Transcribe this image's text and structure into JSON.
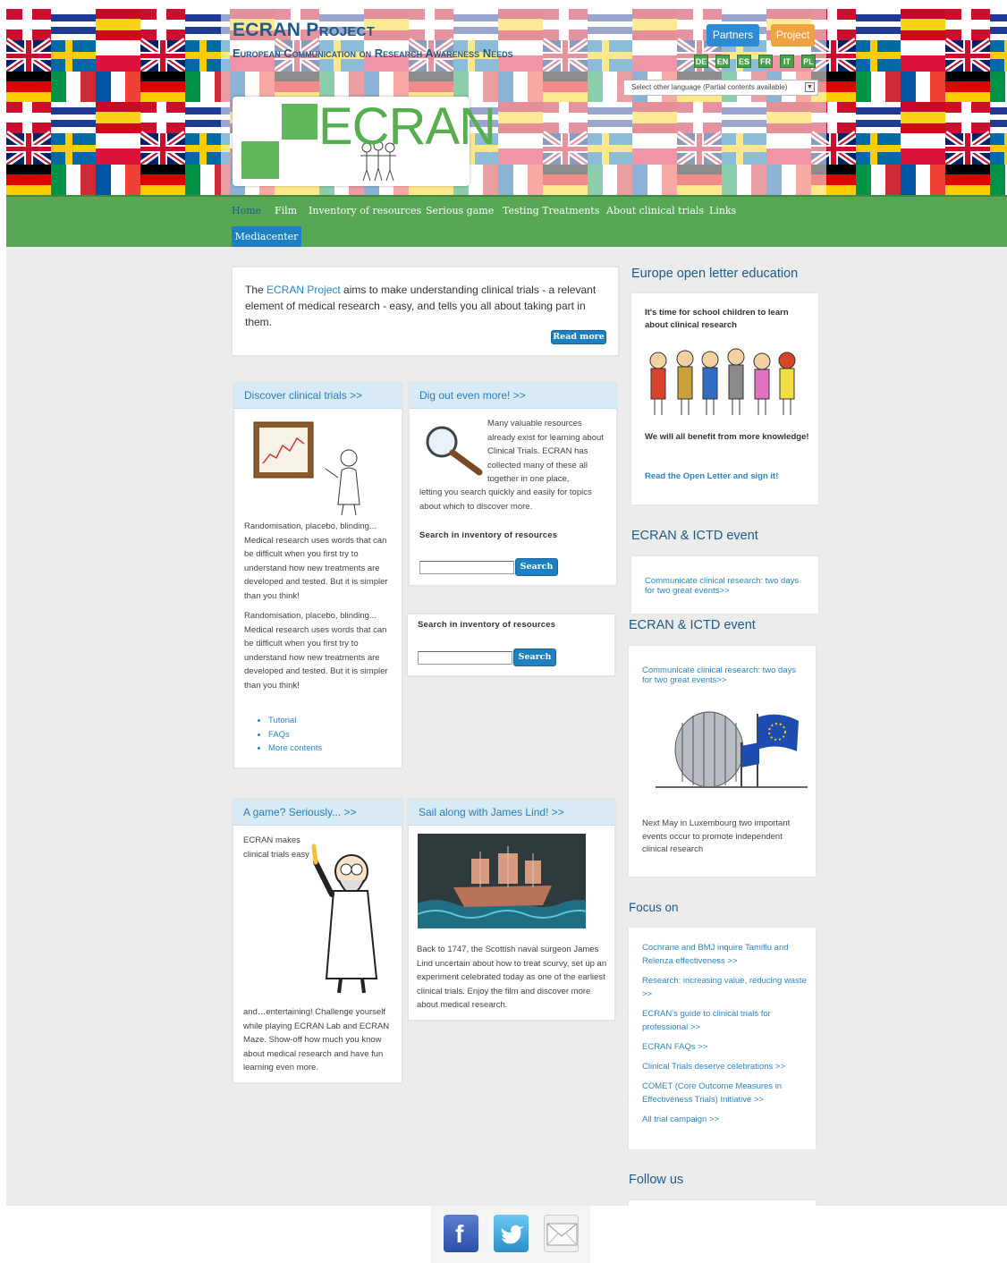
{
  "header": {
    "title": "ECRAN Project",
    "subtitle": "European Communication on Research Awareness Needs",
    "partners_label": "Partners",
    "project_label": "Project",
    "languages": [
      "DE",
      "EN",
      "ES",
      "FR",
      "IT",
      "PL"
    ],
    "language_select": "Select other language (Partial contents available)",
    "logo_text": "ECRAN"
  },
  "nav": {
    "items": [
      "Home",
      "Film",
      "Inventory of resources",
      "Serious game",
      "Testing Treatments",
      "About clinical trials",
      "Links"
    ],
    "mediacenter": "Mediacenter"
  },
  "intro": {
    "prefix": "The ",
    "link": "ECRAN Project",
    "text": " aims to make understanding clinical trials - a relevant element of medical research - easy, and tells you all about taking part in them.",
    "read_more": "Read more"
  },
  "discover": {
    "title": "Discover clinical trials >>",
    "text": "Randomisation, placebo, blinding... Medical research uses words that can be difficult when you first try to understand how new treatments are developed and tested. But it is simpler than you think!",
    "links": [
      "Tutorial",
      "FAQs",
      "More contents"
    ]
  },
  "dig": {
    "title": "Dig out even more! >>",
    "text_a": "Many valuable resources already exist for learning about Clinical Trials. ECRAN has collected many of these all together in one place,",
    "text_b": "letting you search quickly and easily for topics about which to discover more.",
    "search_label": "Search in inventory of resources",
    "search_button": "Search"
  },
  "game": {
    "title": "A game? Seriously... >>",
    "text_a": "ECRAN makes clinical trials easy",
    "text_b": "and…entertaining! Challenge yourself while playing ECRAN Lab and ECRAN Maze. Show-off how much you know about medical research and have fun learning even more."
  },
  "lind": {
    "title": "Sail along with James Lind! >>",
    "text": "Back to 1747, the Scottish naval surgeon James Lind uncertain about how to treat scurvy, set up an experiment celebrated today as one of the earliest clinical trials. Enjoy the film and discover more about medical research."
  },
  "sidebar": {
    "letter_head": "Europe open letter education",
    "letter_intro": "It's time for school children to learn about clinical research",
    "letter_benefit": "We will all benefit from more knowledge!",
    "letter_link": "Read the Open Letter and sign it!",
    "event_head": "ECRAN & ICTD event",
    "event_link": "Communicate clinical research: two days for two great events>>",
    "event_text": "Next May in Luxembourg two important events occur to promote independent clinical research",
    "focus_head": "Focus on",
    "focus_links": [
      "Cochrane and BMJ inquire Tamiflu and Relenza effectiveness >>",
      "Research: increasing value, reducing waste >>",
      "ECRAN's guide to clinical trials for professional >>",
      "ECRAN FAQs >>",
      "Clinical Trials deserve celebrations >>",
      "COMET (Core Outcome Measures in Effectiveness Trials) Initiative >>",
      "All trial campaign >>"
    ],
    "follow_head": "Follow us"
  },
  "social": {
    "icons": [
      "facebook-icon",
      "twitter-icon",
      "email-icon"
    ],
    "facebook_letter": "f",
    "colors": {
      "facebook": "#3b5998",
      "twitter": "#2aa9e0",
      "email": "#e8e8e8"
    }
  },
  "colors": {
    "nav_green": "#57a755",
    "accent_blue": "#1d80c2",
    "title_blue": "#1e5b8a",
    "partners": "#2d8bd6",
    "project": "#f0a141"
  }
}
